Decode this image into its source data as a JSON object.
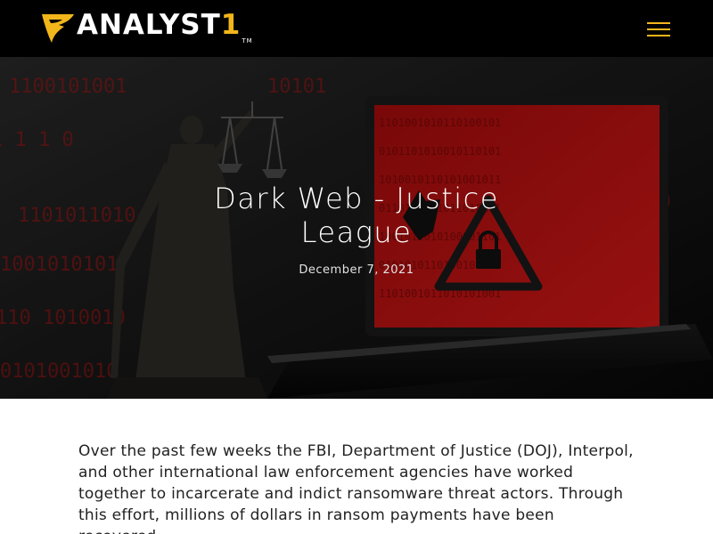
{
  "header": {
    "logo_text": "ANALYST",
    "logo_number": "1",
    "logo_tm": "TM",
    "menu_icon": "hamburger-menu-icon",
    "accent_color": "#f2b61b",
    "background_color": "#000000"
  },
  "hero": {
    "title": "Dark Web - Justice League",
    "date": "December 7, 2021",
    "image": "lady-justice-statue-and-laptop-with-hacked-warning",
    "image_tint": "#c01010"
  },
  "article": {
    "intro": "Over the past few weeks the FBI, Department of Justice (DOJ), Interpol, and other international law enforcement agencies have worked together to incarcerate and indict ransomware threat actors. Through this effort, millions of dollars in ransom payments have been recovered."
  }
}
